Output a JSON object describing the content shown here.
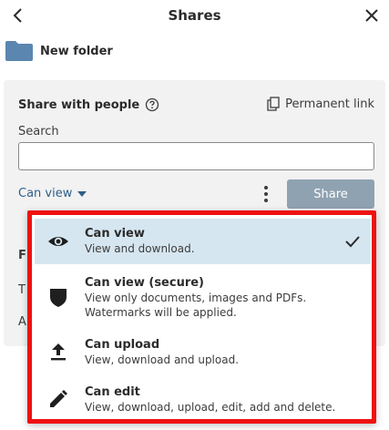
{
  "header": {
    "title": "Shares"
  },
  "folder": {
    "name": "New folder",
    "color": "#5a86b0"
  },
  "share_section": {
    "title": "Share with people",
    "permanent_link_label": "Permanent link",
    "search_label": "Search",
    "search_value": "",
    "permission_selected": "Can view",
    "share_button_label": "Share"
  },
  "background_fragments": {
    "row1": "F",
    "row2": "T",
    "row3": "A"
  },
  "dropdown": {
    "options": [
      {
        "title": "Can view",
        "description": "View and download.",
        "icon": "eye-icon",
        "selected": true
      },
      {
        "title": "Can view (secure)",
        "description": "View only documents, images and PDFs. Watermarks will be applied.",
        "icon": "shield-icon",
        "selected": false
      },
      {
        "title": "Can upload",
        "description": "View, download and upload.",
        "icon": "upload-icon",
        "selected": false
      },
      {
        "title": "Can edit",
        "description": "View, download, upload, edit, add and delete.",
        "icon": "pencil-icon",
        "selected": false
      }
    ],
    "highlight_border_color": "#ee1111",
    "selected_background": "#d6e6f0"
  },
  "colors": {
    "share_button": "#8fa2b1",
    "link_accent": "#2f5f8a"
  }
}
